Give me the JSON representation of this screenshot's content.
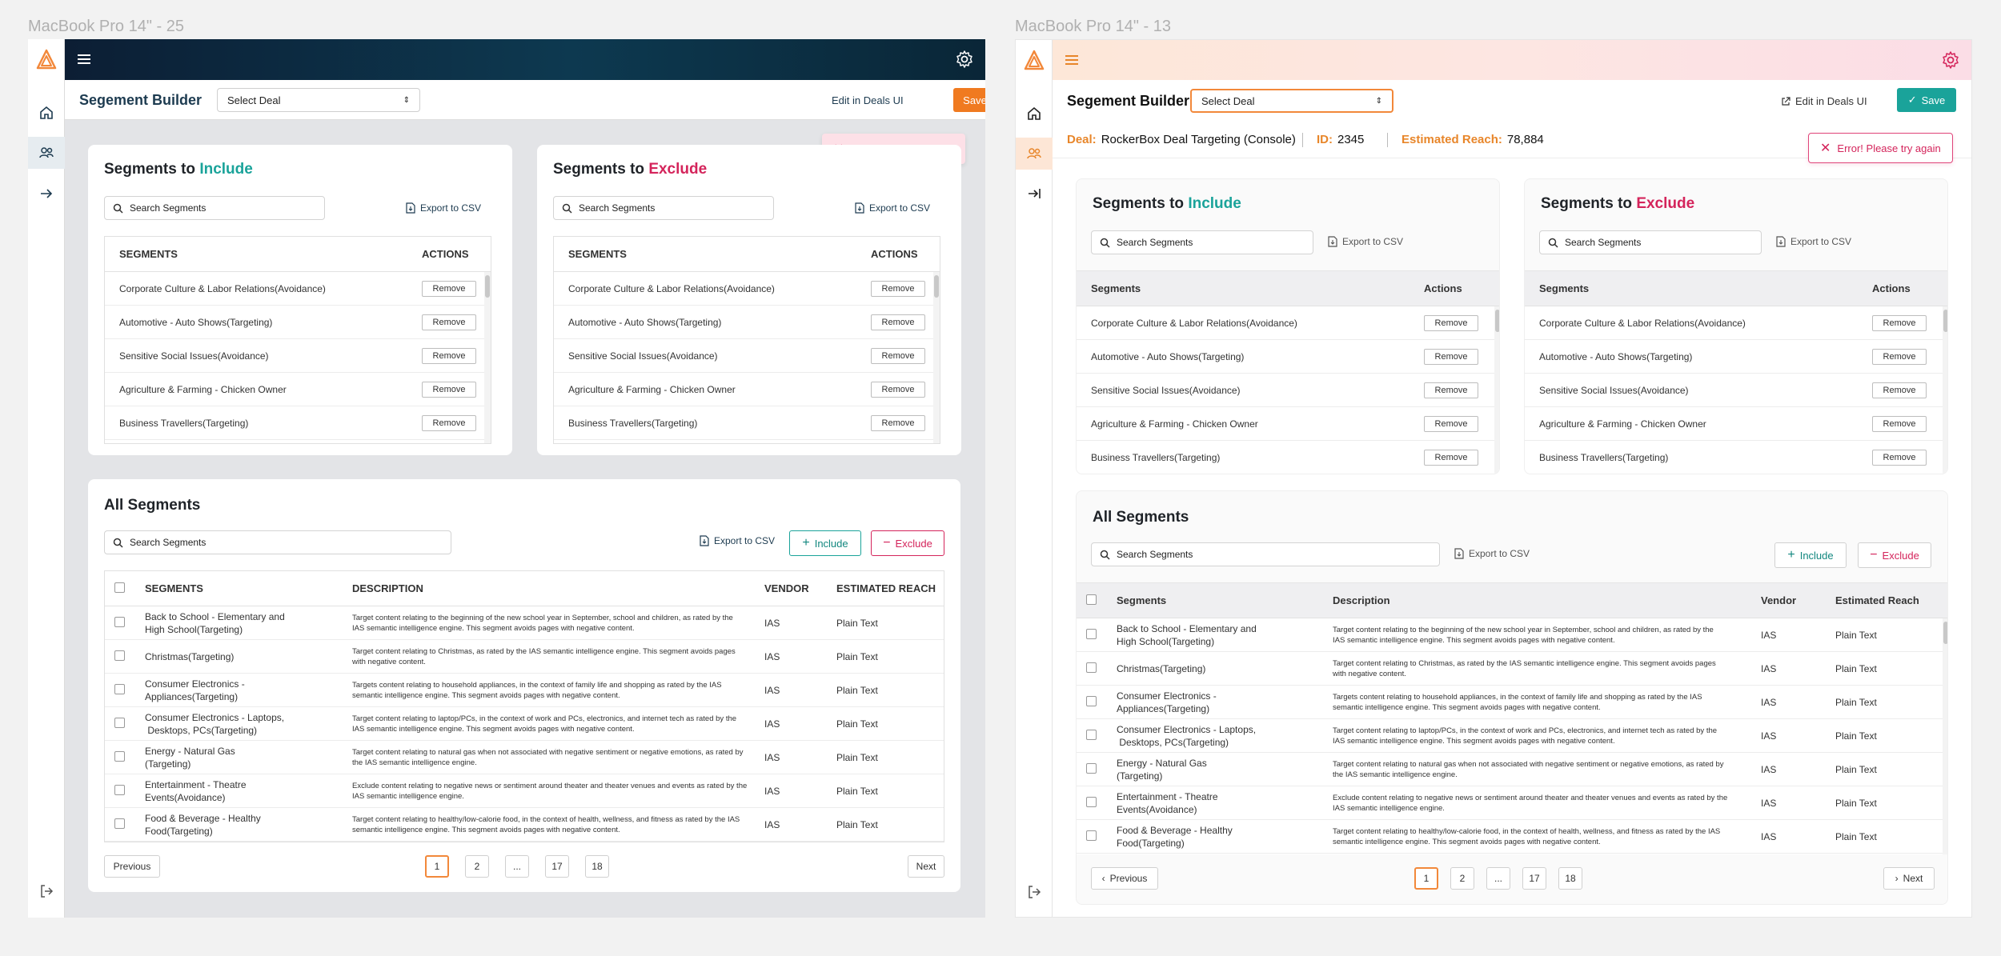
{
  "frames": {
    "left_title": "MacBook Pro 14\" - 25",
    "right_title": "MacBook Pro 14\" - 13"
  },
  "header": {
    "title": "Segement Builder",
    "select_deal": "Select Deal",
    "edit_link": "Edit in Deals UI",
    "save": "Save"
  },
  "deal_info": {
    "deal_label": "Deal:",
    "deal_value": "RockerBox Deal Targeting (Console)",
    "id_label": "ID:",
    "id_value": "2345",
    "reach_label": "Estimated Reach:",
    "reach_value": "78,884"
  },
  "error": "Error! Please try again",
  "include_card": {
    "title_prefix": "Segments to ",
    "title_word": "Include"
  },
  "exclude_card": {
    "title_prefix": "Segments to ",
    "title_word": "Exclude"
  },
  "search_placeholder": "Search Segments",
  "export_label": "Export to CSV",
  "seg_table": {
    "col_segments_upper": "SEGMENTS",
    "col_actions_upper": "ACTIONS",
    "col_segments": "Segments",
    "col_actions": "Actions",
    "remove_label": "Remove",
    "rows": [
      "Corporate Culture & Labor Relations(Avoidance)",
      "Automotive - Auto Shows(Targeting)",
      "Sensitive Social Issues(Avoidance)",
      "Agriculture & Farming - Chicken Owner",
      "Business Travellers(Targeting)"
    ]
  },
  "all_segments": {
    "title": "All Segments",
    "include_btn": "Include",
    "exclude_btn": "Exclude",
    "col_segments_upper": "SEGMENTS",
    "col_description_upper": "DESCRIPTION",
    "col_vendor_upper": "VENDOR",
    "col_reach_upper": "ESTIMATED REACH",
    "col_segments": "Segments",
    "col_description": "Description",
    "col_vendor": "Vendor",
    "col_reach": "Estimated Reach",
    "rows": [
      {
        "name1": "Back to School - Elementary and",
        "name2": "High School(Targeting)",
        "desc1": "Target content relating to the beginning of the new school year in September, school and children, as rated by the",
        "desc2": "IAS semantic intelligence engine. This segment avoids pages with negative content.",
        "vendor": "IAS",
        "reach": "Plain Text"
      },
      {
        "name1": "Christmas(Targeting)",
        "name2": "",
        "desc1": "Target content relating to Christmas, as rated by the IAS semantic intelligence engine. This segment avoids pages",
        "desc2": "with negative content.",
        "vendor": "IAS",
        "reach": "Plain Text"
      },
      {
        "name1": "Consumer Electronics -",
        "name2": "Appliances(Targeting)",
        "desc1": "Targets content relating to household appliances, in the context of family life and shopping as rated by the IAS",
        "desc2": "semantic intelligence engine. This segment avoids pages with negative content.",
        "vendor": "IAS",
        "reach": "Plain Text"
      },
      {
        "name1": "Consumer Electronics - Laptops,",
        "name2": " Desktops, PCs(Targeting)",
        "desc1": "Target content relating to laptop/PCs, in the context of work and PCs, electronics, and internet tech as rated by the",
        "desc2": "IAS semantic intelligence engine. This segment avoids pages with negative content.",
        "vendor": "IAS",
        "reach": "Plain Text"
      },
      {
        "name1": "Energy - Natural Gas",
        "name2": "(Targeting)",
        "desc1": "Target content relating to natural gas when not associated with negative sentiment or negative emotions, as rated by",
        "desc2": "the IAS semantic intelligence engine.",
        "vendor": "IAS",
        "reach": "Plain Text"
      },
      {
        "name1": "Entertainment - Theatre",
        "name2": "Events(Avoidance)",
        "desc1": "Exclude content relating to negative news or sentiment around theater and theater venues and events as rated by the",
        "desc2": "IAS semantic intelligence engine.",
        "vendor": "IAS",
        "reach": "Plain Text"
      },
      {
        "name1": "Food & Beverage - Healthy",
        "name2": "Food(Targeting)",
        "desc1": "Target content relating to healthy/low-calorie food, in the context of health, wellness, and fitness as rated by the IAS",
        "desc2": "semantic intelligence engine. This segment avoids pages with negative content.",
        "vendor": "IAS",
        "reach": "Plain Text"
      }
    ]
  },
  "pagination": {
    "previous": "Previous",
    "next": "Next",
    "pages": [
      "1",
      "2",
      "...",
      "17",
      "18"
    ],
    "current": "1"
  },
  "colors": {
    "accent_orange": "#f2883a",
    "include_teal": "#1aa39a",
    "exclude_pink": "#d4245b",
    "left_topbar": "#0d3950"
  }
}
